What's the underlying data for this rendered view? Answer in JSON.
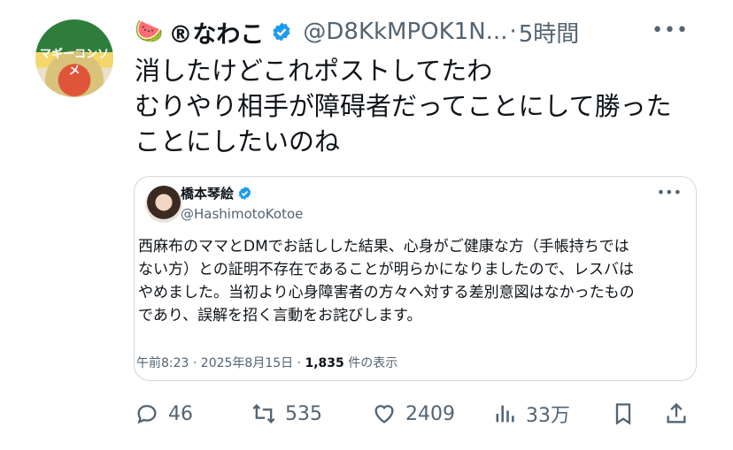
{
  "post": {
    "display_name": "®なわこ",
    "name_emoji": "🍉",
    "handle": "@D8KkMPOK1N...",
    "separator": "·",
    "time": "5時間",
    "avatar_text": "マギーコンソメ",
    "lines": [
      "消したけどこれポストしてたわ",
      "むりやり相手が障碍者だってことにして勝った",
      "ことにしたいのね"
    ]
  },
  "quote": {
    "display_name": "橋本琴絵",
    "handle": "@HashimotoKotoe",
    "lines": [
      "西麻布のママとDMでお話しした結果、心身がご健康な方（手帳持ちでは",
      "ない方）との証明不存在であることが明らかになりましたので、レスバは",
      "やめました。当初より心身障害者の方々へ対する差別意図はなかったもの",
      "であり、誤解を招く言動をお詫びします。"
    ],
    "meta_time": "午前8:23 · 2025年8月15日 · ",
    "views_count": "1,835",
    "views_label": " 件の表示"
  },
  "actions": {
    "replies": "46",
    "reposts": "535",
    "likes": "2409",
    "views": "33万"
  },
  "icons": {
    "verified": "verified-badge-icon",
    "more": "more-options-icon",
    "reply": "reply-icon",
    "repost": "repost-icon",
    "like": "heart-icon",
    "views": "views-chart-icon",
    "bookmark": "bookmark-icon",
    "share": "share-icon"
  },
  "colors": {
    "verified": "#1d9bf0",
    "secondary_text": "#536471",
    "border": "#cfd9de"
  }
}
